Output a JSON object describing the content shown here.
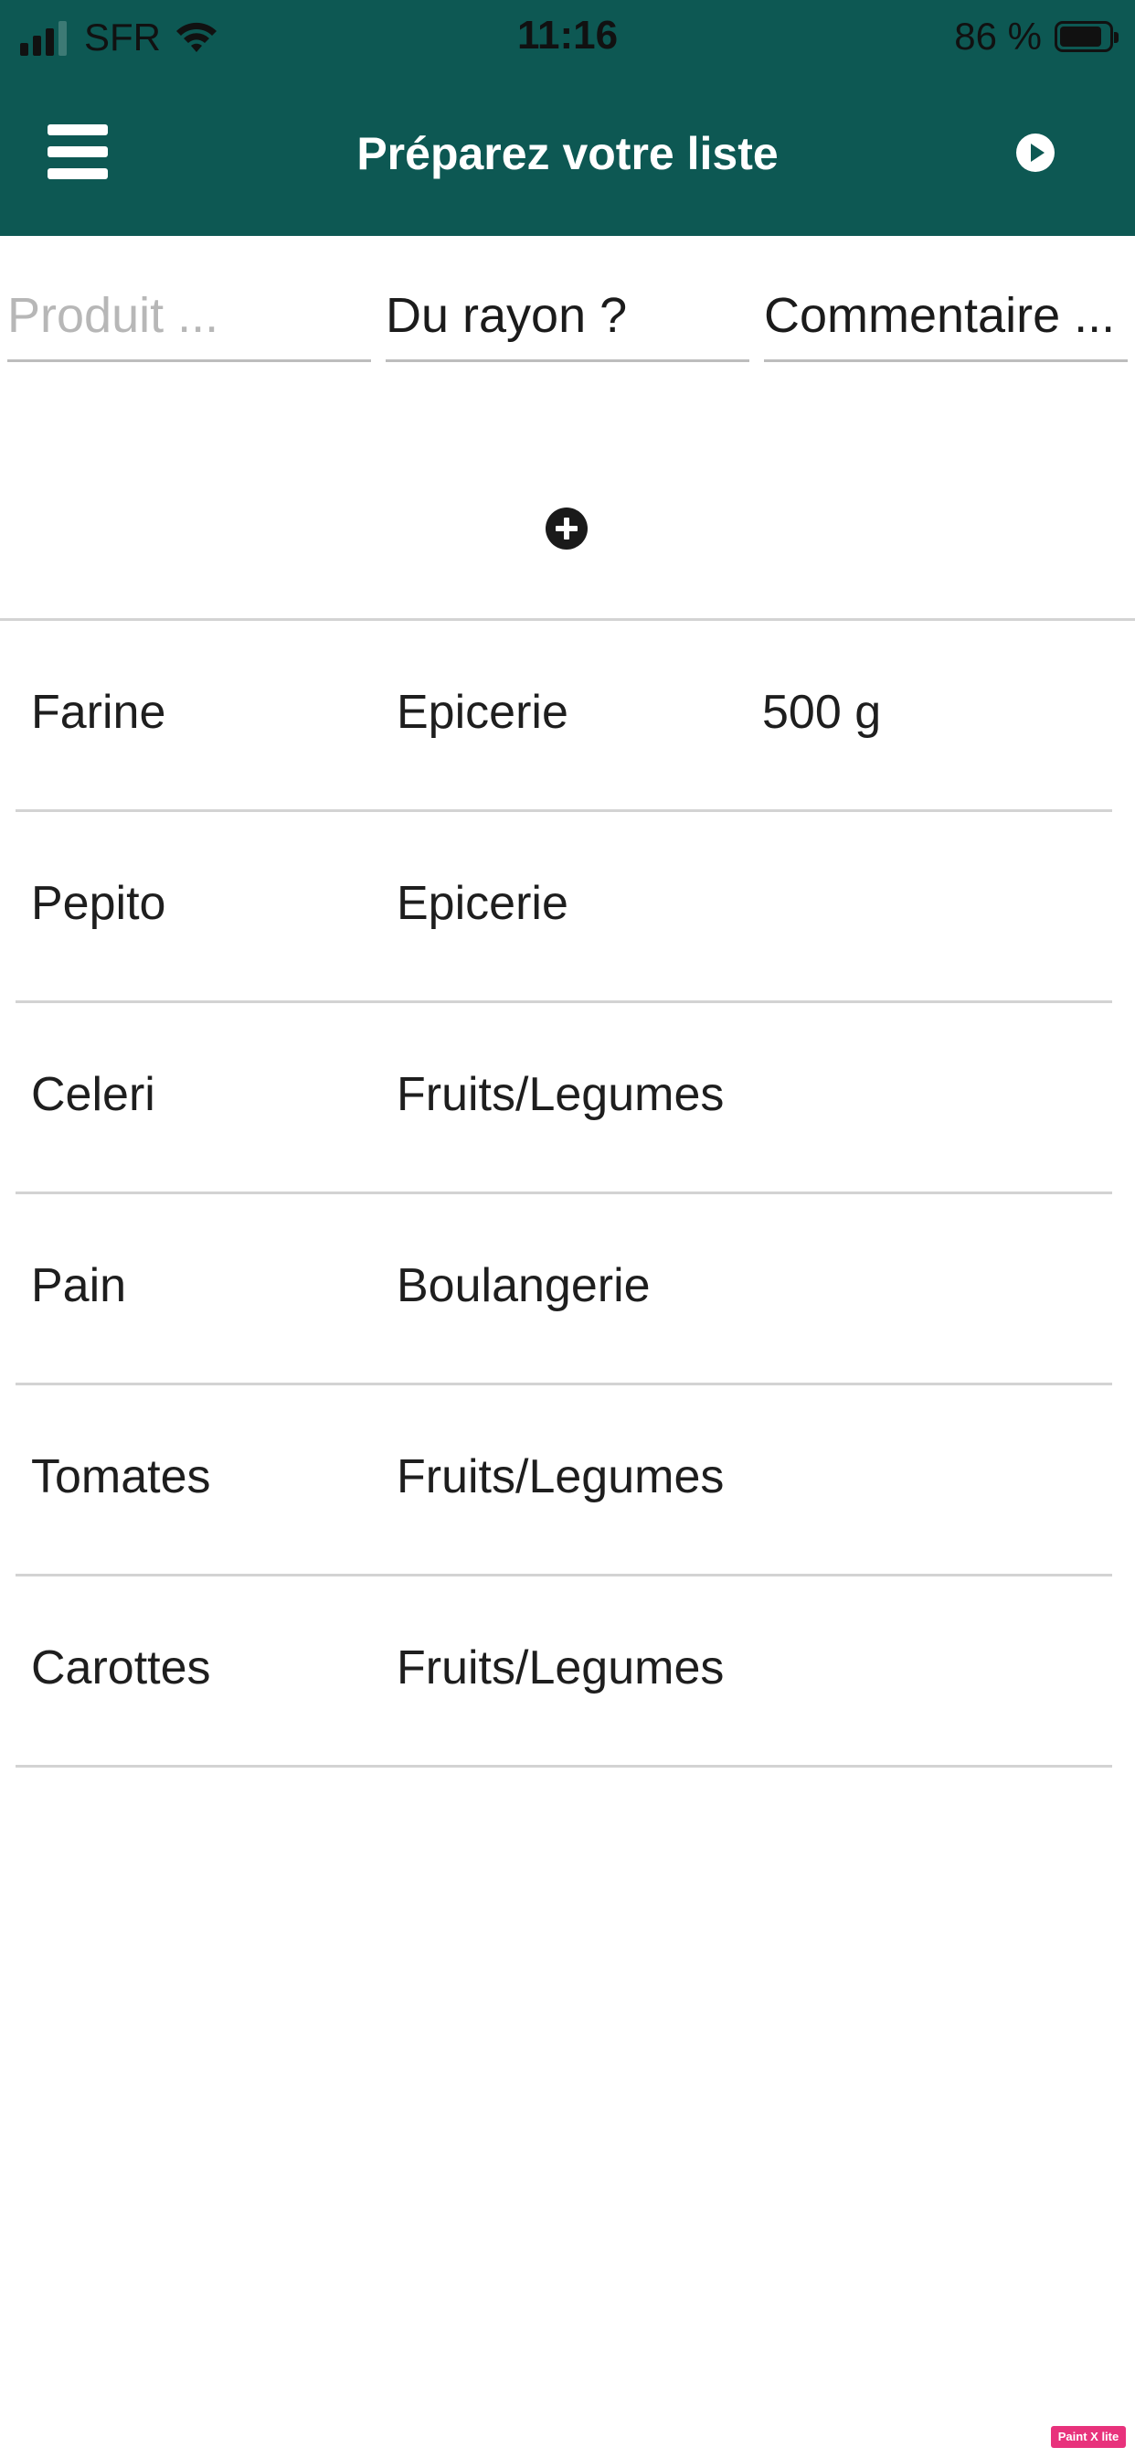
{
  "status_bar": {
    "carrier": "SFR",
    "time": "11:16",
    "battery": "86 %",
    "battery_level": 0.86
  },
  "header": {
    "title": "Préparez votre liste",
    "background_color": "#0d5853",
    "menu_icon": "hamburger-menu-icon",
    "play_icon": "play-circle-icon"
  },
  "form": {
    "product_placeholder": "Produit ...",
    "aisle_placeholder": "Du rayon ?",
    "comment_placeholder": "Commentaire ...",
    "add_icon": "plus-circle-icon"
  },
  "items": [
    {
      "product": "Farine",
      "aisle": "Epicerie",
      "comment": "500 g"
    },
    {
      "product": "Pepito",
      "aisle": "Epicerie",
      "comment": ""
    },
    {
      "product": "Celeri",
      "aisle": "Fruits/Legumes",
      "comment": ""
    },
    {
      "product": "Pain",
      "aisle": "Boulangerie",
      "comment": ""
    },
    {
      "product": "Tomates",
      "aisle": "Fruits/Legumes",
      "comment": ""
    },
    {
      "product": "Carottes",
      "aisle": "Fruits/Legumes",
      "comment": ""
    }
  ],
  "watermark": "Paint X lite"
}
